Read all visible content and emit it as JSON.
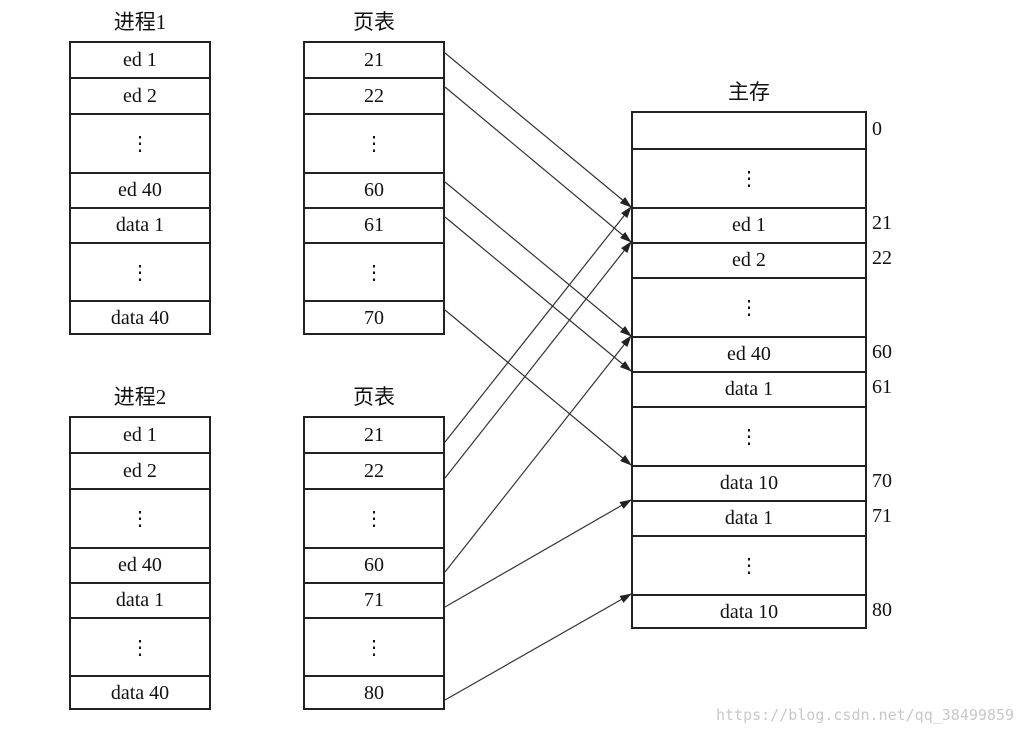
{
  "process1": {
    "title": "进程1",
    "rows": [
      "ed 1",
      "ed 2",
      "⋮",
      "ed 40",
      "data 1",
      "⋮",
      "data 40"
    ]
  },
  "page_table1": {
    "title": "页表",
    "rows": [
      "21",
      "22",
      "⋮",
      "60",
      "61",
      "⋮",
      "70"
    ]
  },
  "process2": {
    "title": "进程2",
    "rows": [
      "ed 1",
      "ed 2",
      "⋮",
      "ed 40",
      "data 1",
      "⋮",
      "data 40"
    ]
  },
  "page_table2": {
    "title": "页表",
    "rows": [
      "21",
      "22",
      "⋮",
      "60",
      "71",
      "⋮",
      "80"
    ]
  },
  "main_memory": {
    "title": "主存",
    "rows": [
      "",
      "⋮",
      "ed 1",
      "ed 2",
      "⋮",
      "ed 40",
      "data 1",
      "⋮",
      "data 10",
      "data 1",
      "⋮",
      "data 10"
    ],
    "addresses": [
      "0",
      "",
      "21",
      "22",
      "",
      "60",
      "61",
      "",
      "70",
      "71",
      "",
      "80"
    ]
  },
  "mappings": [
    {
      "table": "page_table1",
      "row": 0,
      "frame_row": 2
    },
    {
      "table": "page_table1",
      "row": 1,
      "frame_row": 3
    },
    {
      "table": "page_table1",
      "row": 3,
      "frame_row": 5
    },
    {
      "table": "page_table1",
      "row": 4,
      "frame_row": 6
    },
    {
      "table": "page_table1",
      "row": 6,
      "frame_row": 8
    },
    {
      "table": "page_table2",
      "row": 0,
      "frame_row": 2
    },
    {
      "table": "page_table2",
      "row": 1,
      "frame_row": 3
    },
    {
      "table": "page_table2",
      "row": 3,
      "frame_row": 5
    },
    {
      "table": "page_table2",
      "row": 4,
      "frame_row": 9
    },
    {
      "table": "page_table2",
      "row": 6,
      "frame_row": 11
    }
  ],
  "watermark": "https://blog.csdn.net/qq_38499859"
}
